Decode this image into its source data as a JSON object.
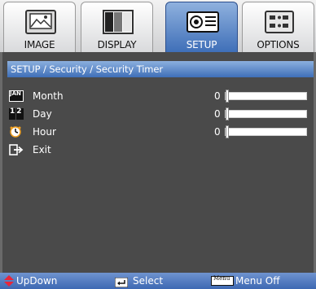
{
  "tabs": [
    {
      "label": "IMAGE",
      "icon": "image-icon",
      "active": false
    },
    {
      "label": "DISPLAY",
      "icon": "display-icon",
      "active": false
    },
    {
      "label": "SETUP",
      "icon": "setup-icon",
      "active": true
    },
    {
      "label": "OPTIONS",
      "icon": "options-icon",
      "active": false
    }
  ],
  "breadcrumb": "SETUP / Security / Security Timer",
  "rows": [
    {
      "label": "Month",
      "value": "0",
      "icon": "month-calendar-icon",
      "icon_text": "JAN",
      "level": 0
    },
    {
      "label": "Day",
      "value": "0",
      "icon": "day-calendar-icon",
      "icon_text": "12",
      "level": 0
    },
    {
      "label": "Hour",
      "value": "0",
      "icon": "clock-icon",
      "level": 0
    },
    {
      "label": "Exit",
      "icon": "exit-icon"
    }
  ],
  "footer": {
    "updown": "UpDown",
    "select": "Select",
    "menu_key": "Menu",
    "menu_off": "Menu Off"
  },
  "colors": {
    "accent": "#3f6fb8",
    "panel_bg": "#4a4a4a",
    "header_bg": "#6f93cf",
    "updown_arrow": "#e8253a"
  }
}
